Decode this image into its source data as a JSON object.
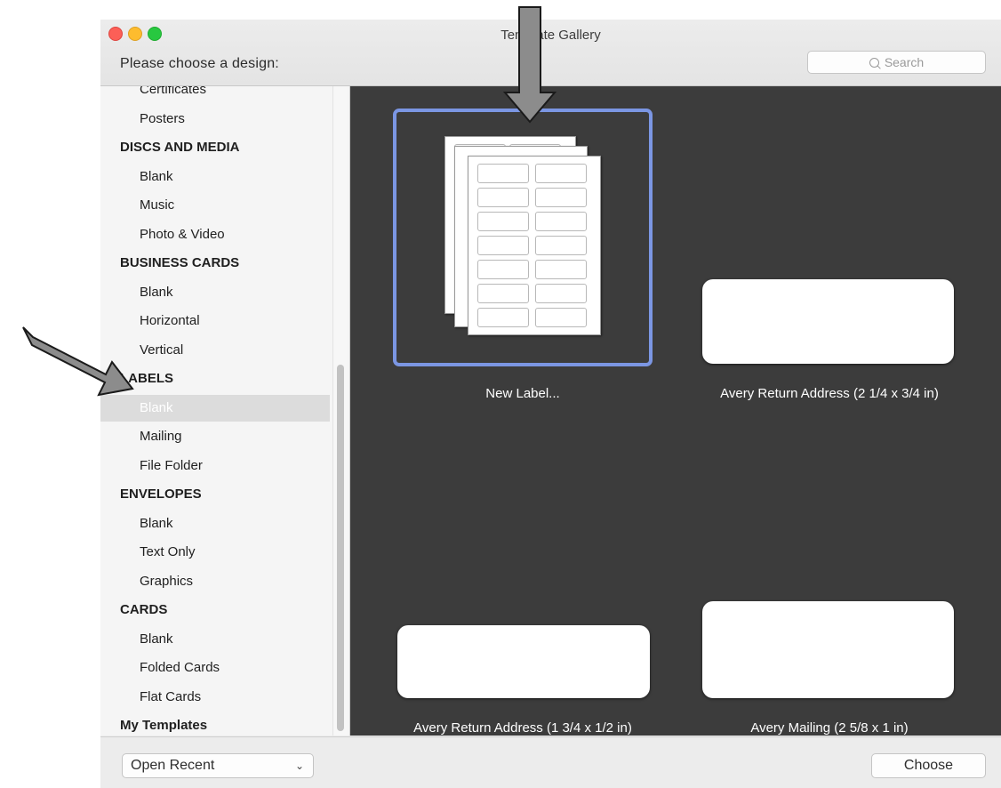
{
  "window": {
    "title": "Template Gallery",
    "prompt": "Please choose a design:",
    "search_placeholder": "Search"
  },
  "sidebar": {
    "items": [
      {
        "label": "Certificates",
        "kind": "sub"
      },
      {
        "label": "Posters",
        "kind": "sub"
      },
      {
        "label": "DISCS AND MEDIA",
        "kind": "cat"
      },
      {
        "label": "Blank",
        "kind": "sub"
      },
      {
        "label": "Music",
        "kind": "sub"
      },
      {
        "label": "Photo & Video",
        "kind": "sub"
      },
      {
        "label": "BUSINESS CARDS",
        "kind": "cat"
      },
      {
        "label": "Blank",
        "kind": "sub"
      },
      {
        "label": "Horizontal",
        "kind": "sub"
      },
      {
        "label": "Vertical",
        "kind": "sub"
      },
      {
        "label": "LABELS",
        "kind": "cat"
      },
      {
        "label": "Blank",
        "kind": "sub",
        "selected": true
      },
      {
        "label": "Mailing",
        "kind": "sub"
      },
      {
        "label": "File Folder",
        "kind": "sub"
      },
      {
        "label": "ENVELOPES",
        "kind": "cat"
      },
      {
        "label": "Blank",
        "kind": "sub"
      },
      {
        "label": "Text Only",
        "kind": "sub"
      },
      {
        "label": "Graphics",
        "kind": "sub"
      },
      {
        "label": "CARDS",
        "kind": "cat"
      },
      {
        "label": "Blank",
        "kind": "sub"
      },
      {
        "label": "Folded Cards",
        "kind": "sub"
      },
      {
        "label": "Flat Cards",
        "kind": "sub"
      },
      {
        "label": "My Templates",
        "kind": "cat"
      }
    ]
  },
  "gallery": {
    "templates": [
      {
        "label": "New Label...",
        "selected": true
      },
      {
        "label": "Avery Return Address (2 1/4 x 3/4 in)"
      },
      {
        "label": "Avery Return Address (1 3/4 x 1/2 in)"
      },
      {
        "label": "Avery Mailing (2 5/8 x 1 in)"
      }
    ]
  },
  "footer": {
    "open_recent": "Open Recent",
    "choose": "Choose"
  },
  "colors": {
    "gallery_bg": "#3c3c3c",
    "selection": "#7b96e3",
    "arrow": "#8c8c8c"
  }
}
